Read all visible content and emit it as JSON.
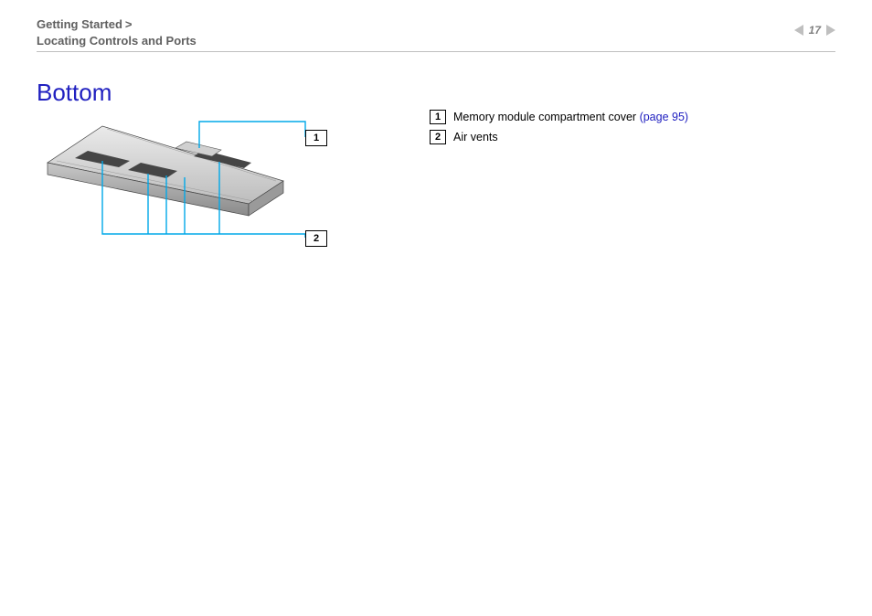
{
  "breadcrumb": {
    "section": "Getting Started",
    "separator": ">",
    "subsection": "Locating Controls and Ports"
  },
  "page_number": "17",
  "title": "Bottom",
  "figure": {
    "callouts": [
      "1",
      "2"
    ]
  },
  "legend": [
    {
      "num": "1",
      "text": "Memory module compartment cover",
      "link": "(page 95)"
    },
    {
      "num": "2",
      "text": "Air vents"
    }
  ]
}
